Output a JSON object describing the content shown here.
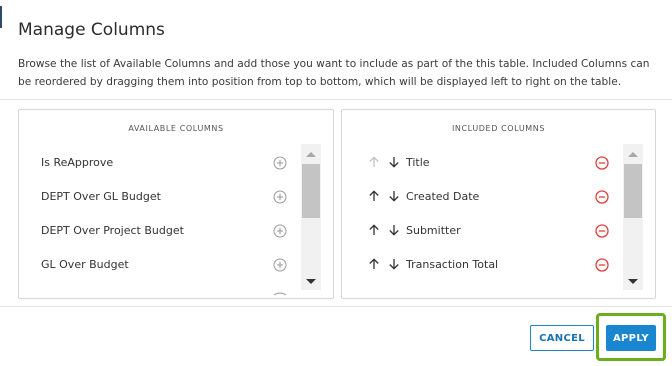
{
  "dialog": {
    "title": "Manage Columns",
    "description": "Browse the list of Available Columns and add those you want to include as part of the this table. Included Columns can be reordered by dragging them into position from top to bottom, which will be displayed left to right on the table."
  },
  "available": {
    "header": "AVAILABLE COLUMNS",
    "items": [
      {
        "label": "Is ReApprove"
      },
      {
        "label": "DEPT Over GL Budget"
      },
      {
        "label": "DEPT Over Project Budget"
      },
      {
        "label": "GL Over Budget"
      }
    ]
  },
  "included": {
    "header": "INCLUDED COLUMNS",
    "items": [
      {
        "label": "Title",
        "up_enabled": false
      },
      {
        "label": "Created Date",
        "up_enabled": true
      },
      {
        "label": "Submitter",
        "up_enabled": true
      },
      {
        "label": "Transaction Total",
        "up_enabled": true
      }
    ]
  },
  "footer": {
    "cancel_label": "CANCEL",
    "apply_label": "APPLY"
  },
  "colors": {
    "primary": "#1a86d0",
    "remove": "#e0403a",
    "highlight": "#6dae1f"
  },
  "icons": {
    "add": "plus-circle-icon",
    "remove": "minus-circle-icon",
    "move_up": "arrow-up-icon",
    "move_down": "arrow-down-icon"
  }
}
